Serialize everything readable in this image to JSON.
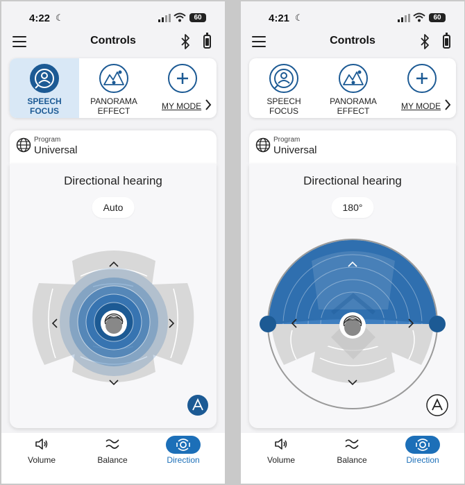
{
  "left": {
    "status": {
      "time": "4:22",
      "battery": "60"
    },
    "header": {
      "title": "Controls"
    },
    "modes": [
      {
        "label_line1": "SPEECH",
        "label_line2": "FOCUS",
        "active": true
      },
      {
        "label_line1": "PANORAMA",
        "label_line2": "EFFECT",
        "active": false
      },
      {
        "label": "MY MODE",
        "active": false
      }
    ],
    "program": {
      "label": "Program",
      "value": "Universal"
    },
    "directional": {
      "title": "Directional hearing",
      "setting": "Auto"
    },
    "tabs": [
      {
        "label": "Volume"
      },
      {
        "label": "Balance"
      },
      {
        "label": "Direction",
        "active": true
      }
    ]
  },
  "right": {
    "status": {
      "time": "4:21",
      "battery": "60"
    },
    "header": {
      "title": "Controls"
    },
    "modes": [
      {
        "label_line1": "SPEECH",
        "label_line2": "FOCUS",
        "active": false
      },
      {
        "label_line1": "PANORAMA",
        "label_line2": "EFFECT",
        "active": false
      },
      {
        "label": "MY MODE",
        "active": false
      }
    ],
    "program": {
      "label": "Program",
      "value": "Universal"
    },
    "directional": {
      "title": "Directional hearing",
      "setting": "180°"
    },
    "tabs": [
      {
        "label": "Volume"
      },
      {
        "label": "Balance"
      },
      {
        "label": "Direction",
        "active": true
      }
    ]
  },
  "colors": {
    "accent": "#1c5a94",
    "accent_light": "#d9e8f6",
    "beam": "#2f6faf",
    "tab_active": "#1c6fb8"
  }
}
